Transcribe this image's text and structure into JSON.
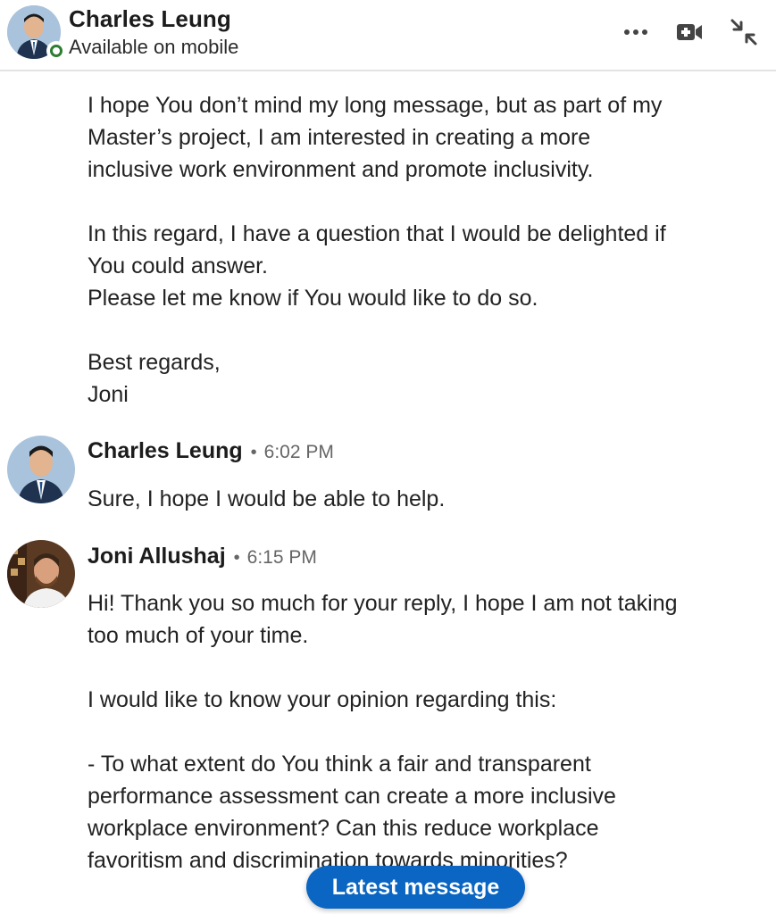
{
  "header": {
    "name": "Charles Leung",
    "status": "Available on mobile",
    "presence_color": "#2e7d32",
    "icons": [
      "more-options-icon",
      "video-call-icon",
      "collapse-icon"
    ]
  },
  "thread": {
    "previous_message_text": "I hope You don’t mind my long message, but as part of my\nMaster’s project, I am interested in creating a more\ninclusive work environment and promote inclusivity.\n\nIn this regard, I have a question that I would be delighted if\nYou could answer.\nPlease let me know if You would like to do so.\n\nBest regards,\nJoni",
    "messages": [
      {
        "sender": "Charles Leung",
        "separator": "•",
        "time": "6:02 PM",
        "text": "Sure, I hope I would be able to help."
      },
      {
        "sender": "Joni Allushaj",
        "separator": "•",
        "time": "6:15 PM",
        "text": "Hi! Thank you so much for your reply, I hope I am not taking\ntoo much of your time.\n\nI would like to know your opinion regarding this:\n\n- To what extent do You think a fair and transparent\nperformance assessment can create a more inclusive\nworkplace environment? Can this reduce workplace\nfavoritism and discrimination towards minorities?"
      }
    ]
  },
  "latest_message_button": "Latest message",
  "colors": {
    "accent": "#0a66c2",
    "timestamp": "#666666"
  }
}
